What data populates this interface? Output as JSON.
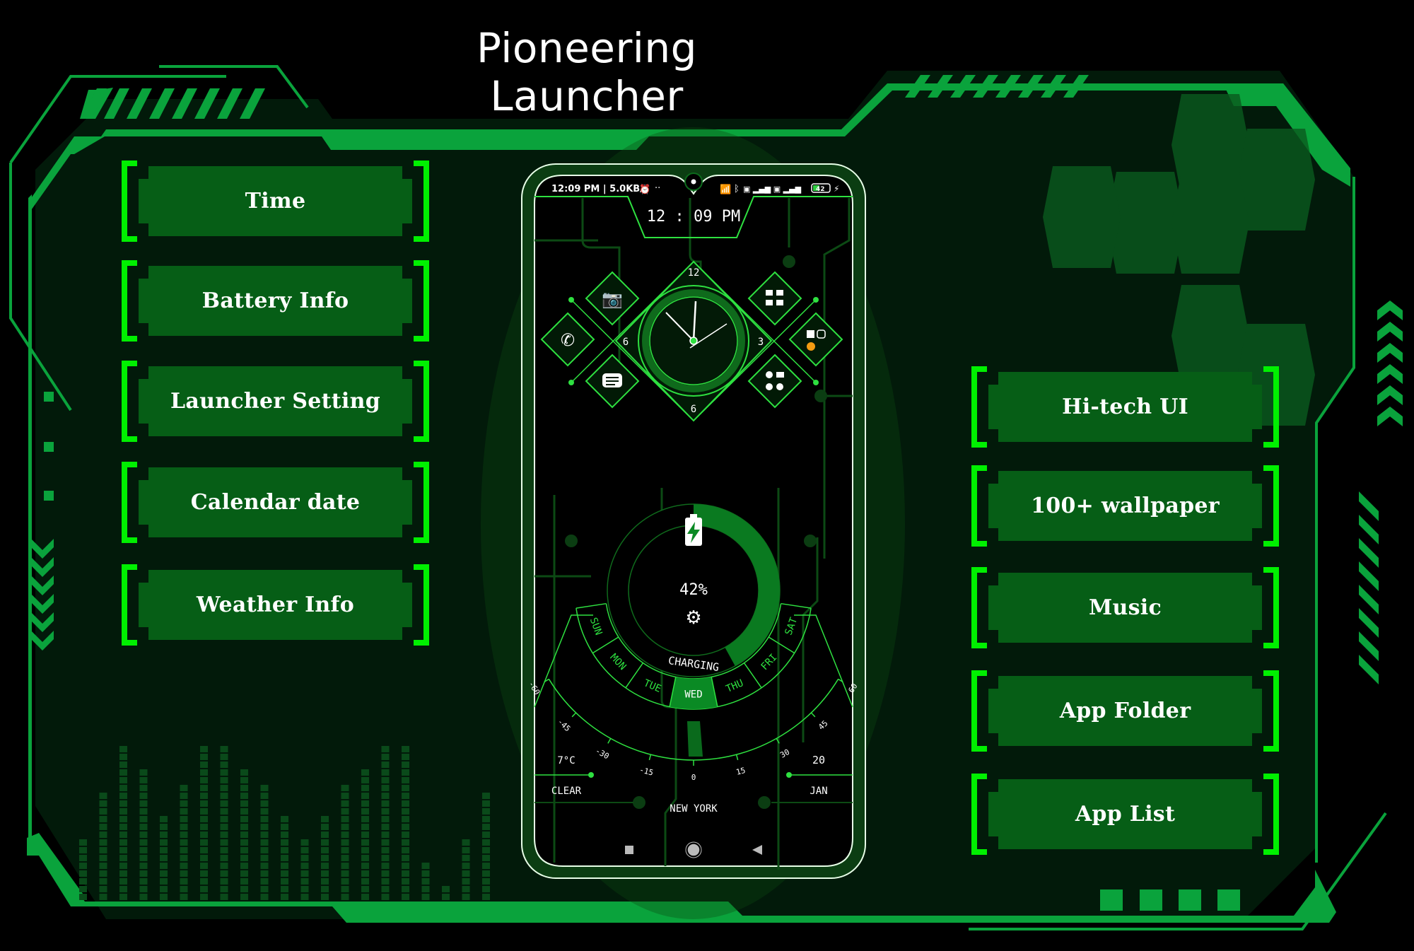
{
  "title": "Pioneering Launcher",
  "colors": {
    "accent": "#00f000",
    "frame": "#0aa33c",
    "plate": "#065e16",
    "panel": "#021a0a"
  },
  "left_buttons": [
    {
      "label": "Time"
    },
    {
      "label": "Battery Info"
    },
    {
      "label": "Launcher Setting"
    },
    {
      "label": "Calendar date"
    },
    {
      "label": "Weather Info"
    }
  ],
  "right_buttons": [
    {
      "label": "Hi-tech UI"
    },
    {
      "label": "100+ wallpaper"
    },
    {
      "label": "Music"
    },
    {
      "label": "App Folder"
    },
    {
      "label": "App List"
    }
  ],
  "phone": {
    "status_bar": {
      "left": "12:09 PM | 5.0KB/s",
      "battery": "42"
    },
    "clock_digital": "12 : 09 PM",
    "clock_labels": {
      "top": "12",
      "left": "6",
      "right": "3",
      "bottom": "6"
    },
    "battery": {
      "percent_label": "42%",
      "percent": 42,
      "status": "CHARGING"
    },
    "weekdays": [
      "SUN",
      "MON",
      "TUE",
      "WED",
      "THU",
      "FRI",
      "SAT"
    ],
    "active_day": "WED",
    "scale_ticks": [
      "-60",
      "-45",
      "-30",
      "-15",
      "0",
      "15",
      "30",
      "45",
      "60"
    ],
    "weather": {
      "temp": "7°C",
      "condition": "CLEAR",
      "city": "NEW YORK"
    },
    "date": {
      "day": "20",
      "month": "JAN"
    },
    "nav": [
      "recents",
      "home",
      "back"
    ]
  }
}
